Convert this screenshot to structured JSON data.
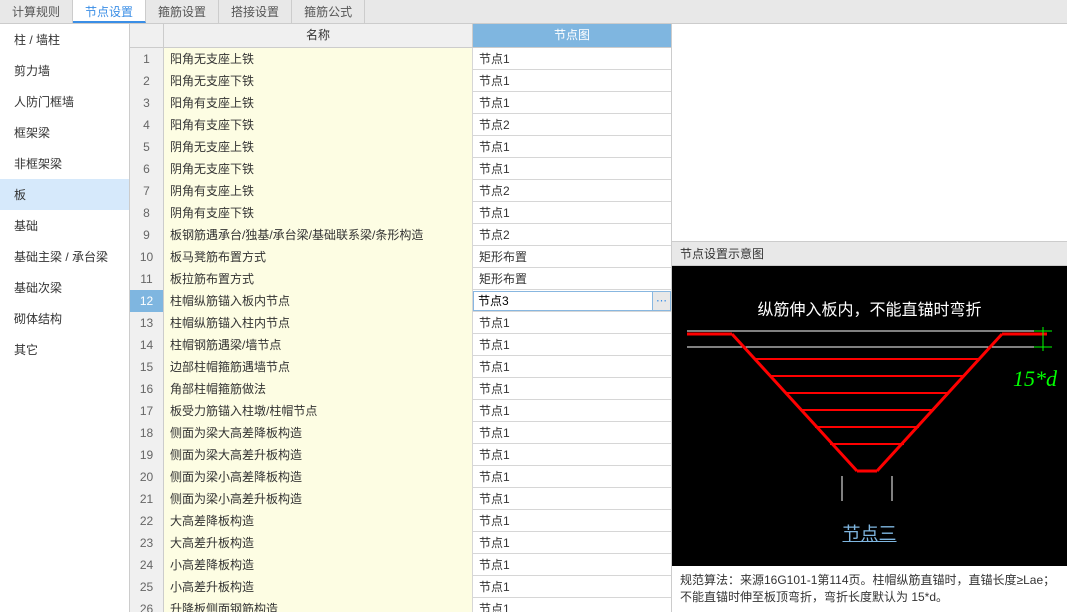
{
  "tabs": [
    {
      "label": "计算规则"
    },
    {
      "label": "节点设置"
    },
    {
      "label": "箍筋设置"
    },
    {
      "label": "搭接设置"
    },
    {
      "label": "箍筋公式"
    }
  ],
  "active_tab": 1,
  "sidebar": {
    "items": [
      {
        "label": "柱 / 墙柱"
      },
      {
        "label": "剪力墙"
      },
      {
        "label": "人防门框墙"
      },
      {
        "label": "框架梁"
      },
      {
        "label": "非框架梁"
      },
      {
        "label": "板"
      },
      {
        "label": "基础"
      },
      {
        "label": "基础主梁 / 承台梁"
      },
      {
        "label": "基础次梁"
      },
      {
        "label": "砌体结构"
      },
      {
        "label": "其它"
      }
    ],
    "active": 5
  },
  "grid": {
    "header_name": "名称",
    "header_node": "节点图",
    "rows": [
      {
        "n": "1",
        "name": "阳角无支座上铁",
        "node": "节点1"
      },
      {
        "n": "2",
        "name": "阳角无支座下铁",
        "node": "节点1"
      },
      {
        "n": "3",
        "name": "阳角有支座上铁",
        "node": "节点1"
      },
      {
        "n": "4",
        "name": "阳角有支座下铁",
        "node": "节点2"
      },
      {
        "n": "5",
        "name": "阴角无支座上铁",
        "node": "节点1"
      },
      {
        "n": "6",
        "name": "阴角无支座下铁",
        "node": "节点1"
      },
      {
        "n": "7",
        "name": "阴角有支座上铁",
        "node": "节点2"
      },
      {
        "n": "8",
        "name": "阴角有支座下铁",
        "node": "节点1"
      },
      {
        "n": "9",
        "name": "板钢筋遇承台/独基/承台梁/基础联系梁/条形构造",
        "node": "节点2"
      },
      {
        "n": "10",
        "name": "板马凳筋布置方式",
        "node": "矩形布置"
      },
      {
        "n": "11",
        "name": "板拉筋布置方式",
        "node": "矩形布置"
      },
      {
        "n": "12",
        "name": "柱帽纵筋锚入板内节点",
        "node": "节点3"
      },
      {
        "n": "13",
        "name": "柱帽纵筋锚入柱内节点",
        "node": "节点1"
      },
      {
        "n": "14",
        "name": "柱帽钢筋遇梁/墙节点",
        "node": "节点1"
      },
      {
        "n": "15",
        "name": "边部柱帽箍筋遇墙节点",
        "node": "节点1"
      },
      {
        "n": "16",
        "name": "角部柱帽箍筋做法",
        "node": "节点1"
      },
      {
        "n": "17",
        "name": "板受力筋锚入柱墩/柱帽节点",
        "node": "节点1"
      },
      {
        "n": "18",
        "name": "侧面为梁大高差降板构造",
        "node": "节点1"
      },
      {
        "n": "19",
        "name": "侧面为梁大高差升板构造",
        "node": "节点1"
      },
      {
        "n": "20",
        "name": "侧面为梁小高差降板构造",
        "node": "节点1"
      },
      {
        "n": "21",
        "name": "侧面为梁小高差升板构造",
        "node": "节点1"
      },
      {
        "n": "22",
        "name": "大高差降板构造",
        "node": "节点1"
      },
      {
        "n": "23",
        "name": "大高差升板构造",
        "node": "节点1"
      },
      {
        "n": "24",
        "name": "小高差降板构造",
        "node": "节点1"
      },
      {
        "n": "25",
        "name": "小高差升板构造",
        "node": "节点1"
      },
      {
        "n": "26",
        "name": "升降板侧面钢筋构造",
        "node": "节点1"
      }
    ],
    "selected": 11,
    "editing_value": "节点3"
  },
  "preview": {
    "title": "节点设置示意图",
    "text1": "纵筋伸入板内，不能直锚时弯折",
    "dim_text": "15*d",
    "node_label": "节点三",
    "desc": "规范算法：来源16G101-1第114页。柱帽纵筋直锚时，直锚长度≥Lae；不能直锚时伸至板顶弯折，弯折长度默认为 15*d。"
  }
}
